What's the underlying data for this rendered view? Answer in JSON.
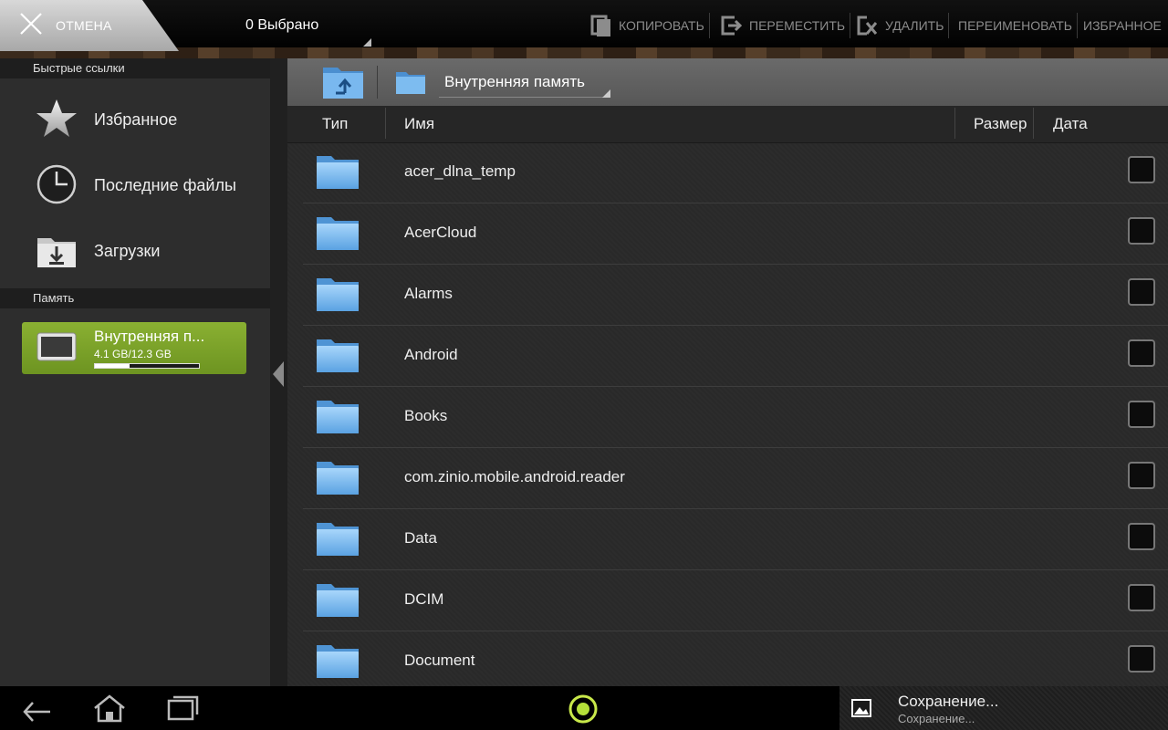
{
  "topbar": {
    "cancel_label": "ОТМЕНА",
    "selected_label": "0 Выбрано",
    "actions": {
      "copy": "КОПИРОВАТЬ",
      "move": "ПЕРЕМЕСТИТЬ",
      "delete": "УДАЛИТЬ",
      "rename": "ПЕРЕИМЕНОВАТЬ",
      "favorite": "ИЗБРАННОЕ"
    }
  },
  "sidebar": {
    "quick_links_header": "Быстрые ссылки",
    "quick_links": [
      {
        "label": "Избранное",
        "icon": "star-icon"
      },
      {
        "label": "Последние файлы",
        "icon": "clock-icon"
      },
      {
        "label": "Загрузки",
        "icon": "download-folder-icon"
      }
    ],
    "memory_header": "Память",
    "storage": {
      "name": "Внутренняя п...",
      "size": "4.1 GB/12.3 GB",
      "used_fraction": 0.33,
      "icon": "tablet-icon"
    }
  },
  "path": {
    "current": "Внутренняя память"
  },
  "columns": {
    "type": "Тип",
    "name": "Имя",
    "size": "Размер",
    "date": "Дата"
  },
  "files": [
    {
      "name": "acer_dlna_temp"
    },
    {
      "name": "AcerCloud"
    },
    {
      "name": "Alarms"
    },
    {
      "name": "Android"
    },
    {
      "name": "Books"
    },
    {
      "name": "com.zinio.mobile.android.reader"
    },
    {
      "name": "Data"
    },
    {
      "name": "DCIM"
    },
    {
      "name": "Document"
    }
  ],
  "notification": {
    "title": "Сохранение...",
    "subtitle": "Сохранение...",
    "icon": "image-icon"
  },
  "colors": {
    "accent": "#7ea32c",
    "folder": "#6aaee8"
  }
}
